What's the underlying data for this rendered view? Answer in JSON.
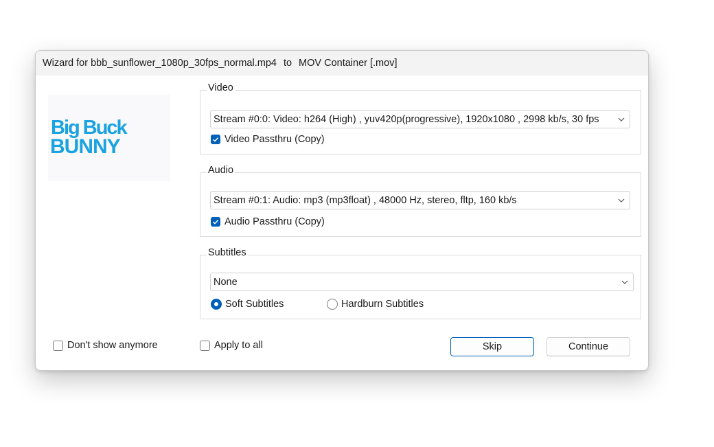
{
  "window": {
    "title_file": "Wizard for bbb_sunflower_1080p_30fps_normal.mp4",
    "title_to": "to",
    "title_target": "MOV Container [.mov]"
  },
  "logo": {
    "line1": "Big Buck",
    "line2": "BUNNY",
    "color": "#1aa3e0"
  },
  "video": {
    "label": "Video",
    "stream": "Stream #0:0: Video: h264 (High) , yuv420p(progressive), 1920x1080 , 2998 kb/s, 30 fps",
    "passthru_label": "Video Passthru (Copy)",
    "passthru_checked": true
  },
  "audio": {
    "label": "Audio",
    "stream": "Stream #0:1: Audio: mp3 (mp3float) , 48000 Hz, stereo, fltp, 160 kb/s",
    "passthru_label": "Audio Passthru (Copy)",
    "passthru_checked": true
  },
  "subtitles": {
    "label": "Subtitles",
    "selected": "None",
    "soft_label": "Soft Subtitles",
    "hardburn_label": "Hardburn Subtitles",
    "mode": "soft"
  },
  "footer": {
    "dont_show_label": "Don't show anymore",
    "apply_all_label": "Apply to all",
    "skip_label": "Skip",
    "continue_label": "Continue"
  },
  "colors": {
    "accent": "#005fb8"
  }
}
